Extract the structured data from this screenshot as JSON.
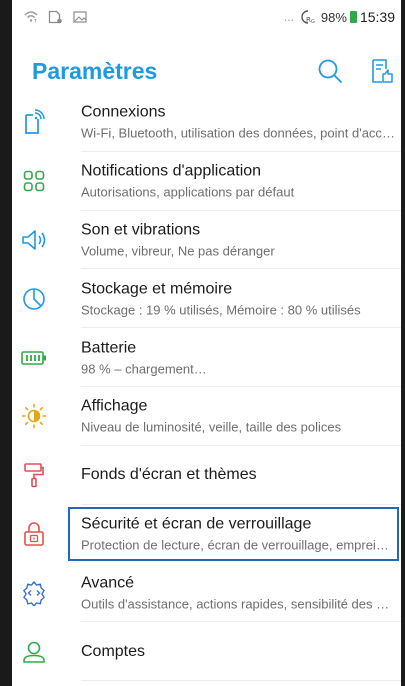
{
  "status": {
    "dots": "...",
    "battery": "98%",
    "time": "15:39"
  },
  "header": {
    "title": "Paramètres"
  },
  "colors": {
    "accent": "#1f9ae0",
    "selection_border": "#2467b8",
    "icon_primary": "#1f9ae0",
    "icon_green": "#33a84a",
    "icon_yellow": "#e0a81a",
    "icon_red": "#e05050",
    "icon_purple": "#3c6ed8"
  },
  "settings": [
    {
      "label": "Connexions",
      "sub": "Wi-Fi, Bluetooth, utilisation des données, point d'accès…",
      "icon": "phone-wireless-icon"
    },
    {
      "label": "Notifications d'application",
      "sub": "Autorisations, applications par défaut",
      "icon": "apps-grid-icon"
    },
    {
      "label": "Son et vibrations",
      "sub": "Volume, vibreur, Ne pas déranger",
      "icon": "speaker-icon"
    },
    {
      "label": "Stockage et mémoire",
      "sub": "Stockage : 19 % utilisés, Mémoire : 80 % utilisés",
      "icon": "pie-chart-icon"
    },
    {
      "label": "Batterie",
      "sub": "98 % – chargement…",
      "icon": "battery-icon"
    },
    {
      "label": "Affichage",
      "sub": "Niveau de luminosité, veille, taille des polices",
      "icon": "brightness-icon"
    },
    {
      "label": "Fonds d'écran et thèmes",
      "sub": "",
      "icon": "paint-roller-icon"
    },
    {
      "label": "Sécurité et écran de verrouillage",
      "sub": "Protection de lecture, écran de verrouillage, empreinte digitale",
      "icon": "lock-icon"
    },
    {
      "label": "Avancé",
      "sub": "Outils d'assistance, actions rapides, sensibilité des gestes…",
      "icon": "gear-advanced-icon"
    },
    {
      "label": "Comptes",
      "sub": "",
      "icon": "account-icon"
    }
  ]
}
